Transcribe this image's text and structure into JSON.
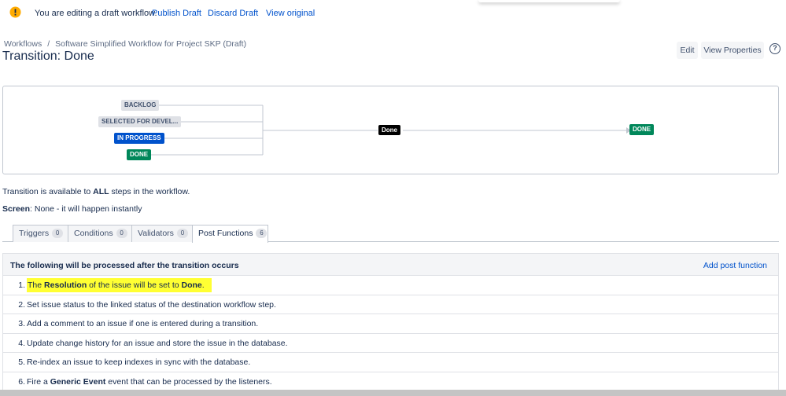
{
  "banner": {
    "message": "You are editing a draft workflow.",
    "publish_label": "Publish Draft",
    "discard_label": "Discard Draft",
    "view_original_label": "View original",
    "icon": "warning-icon",
    "icon_color": "#ffab00"
  },
  "header": {
    "breadcrumb": {
      "root": "Workflows",
      "separator": "/",
      "current": "Software Simplified Workflow for Project SKP (Draft)"
    },
    "title": "Transition: Done",
    "edit_label": "Edit",
    "view_properties_label": "View Properties",
    "help_icon": "help-icon"
  },
  "diagram": {
    "sources": [
      {
        "label": "BACKLOG",
        "style": "grey"
      },
      {
        "label": "SELECTED FOR DEVEL...",
        "style": "grey"
      },
      {
        "label": "IN PROGRESS",
        "style": "blue"
      },
      {
        "label": "DONE",
        "style": "green"
      }
    ],
    "transition_label": "Done",
    "target": {
      "label": "DONE",
      "style": "green"
    }
  },
  "info": {
    "availability_prefix": "Transition is available to ",
    "availability_bold": "ALL",
    "availability_suffix": " steps in the workflow.",
    "screen_label": "Screen",
    "screen_value": ": None - it will happen instantly"
  },
  "tabs": [
    {
      "label": "Triggers",
      "count": "0",
      "active": false
    },
    {
      "label": "Conditions",
      "count": "0",
      "active": false
    },
    {
      "label": "Validators",
      "count": "0",
      "active": false
    },
    {
      "label": "Post Functions",
      "count": "6",
      "active": true
    }
  ],
  "post_functions": {
    "heading": "The following will be processed after the transition occurs",
    "add_label": "Add post function",
    "items": [
      {
        "num": "1.",
        "p1": "The ",
        "b1": "Resolution",
        "p2": " of the issue will be set to ",
        "b2": "Done",
        "p3": "."
      },
      {
        "num": "2.",
        "p1": "Set issue status to the linked status of the destination workflow step.",
        "b1": "",
        "p2": "",
        "b2": "",
        "p3": ""
      },
      {
        "num": "3.",
        "p1": "Add a comment to an issue if one is entered during a transition.",
        "b1": "",
        "p2": "",
        "b2": "",
        "p3": ""
      },
      {
        "num": "4.",
        "p1": "Update change history for an issue and store the issue in the database.",
        "b1": "",
        "p2": "",
        "b2": "",
        "p3": ""
      },
      {
        "num": "5.",
        "p1": "Re-index an issue to keep indexes in sync with the database.",
        "b1": "",
        "p2": "",
        "b2": "",
        "p3": ""
      },
      {
        "num": "6.",
        "p1": "Fire a ",
        "b1": "Generic Event",
        "p2": " event that can be processed by the listeners.",
        "b2": "",
        "p3": ""
      }
    ]
  },
  "colors": {
    "link": "#0052cc",
    "highlight": "#ffff33",
    "status_grey": "#dfe1e6",
    "status_blue": "#0052cc",
    "status_green": "#00875a"
  }
}
